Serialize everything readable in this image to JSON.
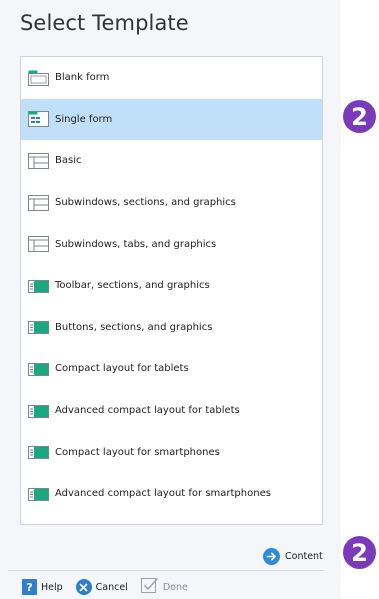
{
  "dialog": {
    "title": "Select Template"
  },
  "templates": [
    {
      "label": "Blank form",
      "icon": "blank-form-icon",
      "selected": false
    },
    {
      "label": "Single form",
      "icon": "single-form-icon",
      "selected": true
    },
    {
      "label": "Basic",
      "icon": "basic-template-icon",
      "selected": false
    },
    {
      "label": "Subwindows, sections, and graphics",
      "icon": "subwindows-template-icon",
      "selected": false
    },
    {
      "label": "Subwindows, tabs, and graphics",
      "icon": "subwindows-template-icon",
      "selected": false
    },
    {
      "label": "Toolbar, sections, and graphics",
      "icon": "teal-template-icon",
      "selected": false
    },
    {
      "label": "Buttons, sections, and graphics",
      "icon": "teal-template-icon",
      "selected": false
    },
    {
      "label": "Compact layout for tablets",
      "icon": "teal-template-icon",
      "selected": false
    },
    {
      "label": "Advanced compact layout for tablets",
      "icon": "teal-template-icon",
      "selected": false
    },
    {
      "label": "Compact layout for smartphones",
      "icon": "teal-template-icon",
      "selected": false
    },
    {
      "label": "Advanced compact layout for smartphones",
      "icon": "teal-template-icon",
      "selected": false
    }
  ],
  "content_link": {
    "label": "Content",
    "icon": "arrow-right-circle-icon"
  },
  "footer": {
    "help_label": "Help",
    "help_icon": "help-icon",
    "cancel_label": "Cancel",
    "cancel_icon": "cancel-icon",
    "done_label": "Done",
    "done_icon": "checkmark-icon"
  },
  "badges": {
    "top": "2",
    "bottom": "2"
  },
  "colors": {
    "selected_row": "#bfe0f8",
    "accent_blue": "#2f7fcc",
    "teal_icon": "#1aa882",
    "badge": "#7b3ab9"
  }
}
